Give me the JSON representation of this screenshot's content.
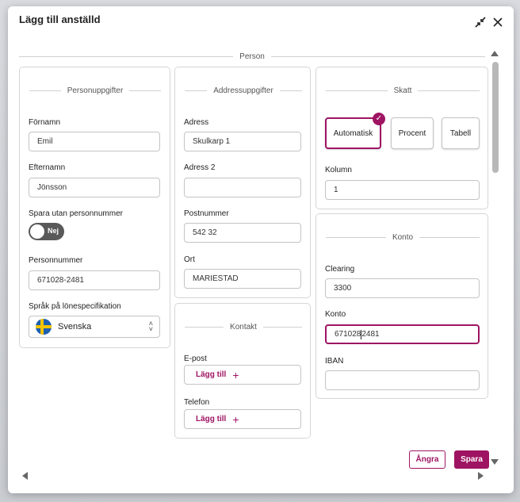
{
  "modal": {
    "title": "Lägg till anställd",
    "section_label": "Person"
  },
  "personal": {
    "heading": "Personuppgifter",
    "first_name_label": "Förnamn",
    "first_name_value": "Emil",
    "last_name_label": "Efternamn",
    "last_name_value": "Jönsson",
    "no_ssn_label": "Spara utan personnummer",
    "no_ssn_toggle": "Nej",
    "ssn_label": "Personnummer",
    "ssn_value": "671028-2481",
    "language_label": "Språk på lönespecifikation",
    "language_value": "Svenska"
  },
  "address": {
    "heading": "Addressuppgifter",
    "address_label": "Adress",
    "address_value": "Skulkarp 1",
    "address2_label": "Adress 2",
    "address2_value": "",
    "postal_label": "Postnummer",
    "postal_value": "542 32",
    "city_label": "Ort",
    "city_value": "MARIESTAD"
  },
  "contact": {
    "heading": "Kontakt",
    "email_label": "E-post",
    "email_add": "Lägg till",
    "phone_label": "Telefon",
    "phone_add": "Lägg till"
  },
  "tax": {
    "heading": "Skatt",
    "options": [
      "Automatisk",
      "Procent",
      "Tabell"
    ],
    "selected": "Automatisk",
    "column_label": "Kolumn",
    "column_value": "1"
  },
  "account": {
    "heading": "Konto",
    "clearing_label": "Clearing",
    "clearing_value": "3300",
    "account_label": "Konto",
    "account_value_before_caret": "671028",
    "account_value_after_caret": "2481",
    "iban_label": "IBAN",
    "iban_value": ""
  },
  "footer": {
    "undo_label": "Ångra",
    "save_label": "Spara"
  },
  "colors": {
    "accent": "#9e1463",
    "border": "#c4c4c4"
  },
  "icons": {
    "minimize": "compress-icon",
    "close": "close-icon"
  }
}
